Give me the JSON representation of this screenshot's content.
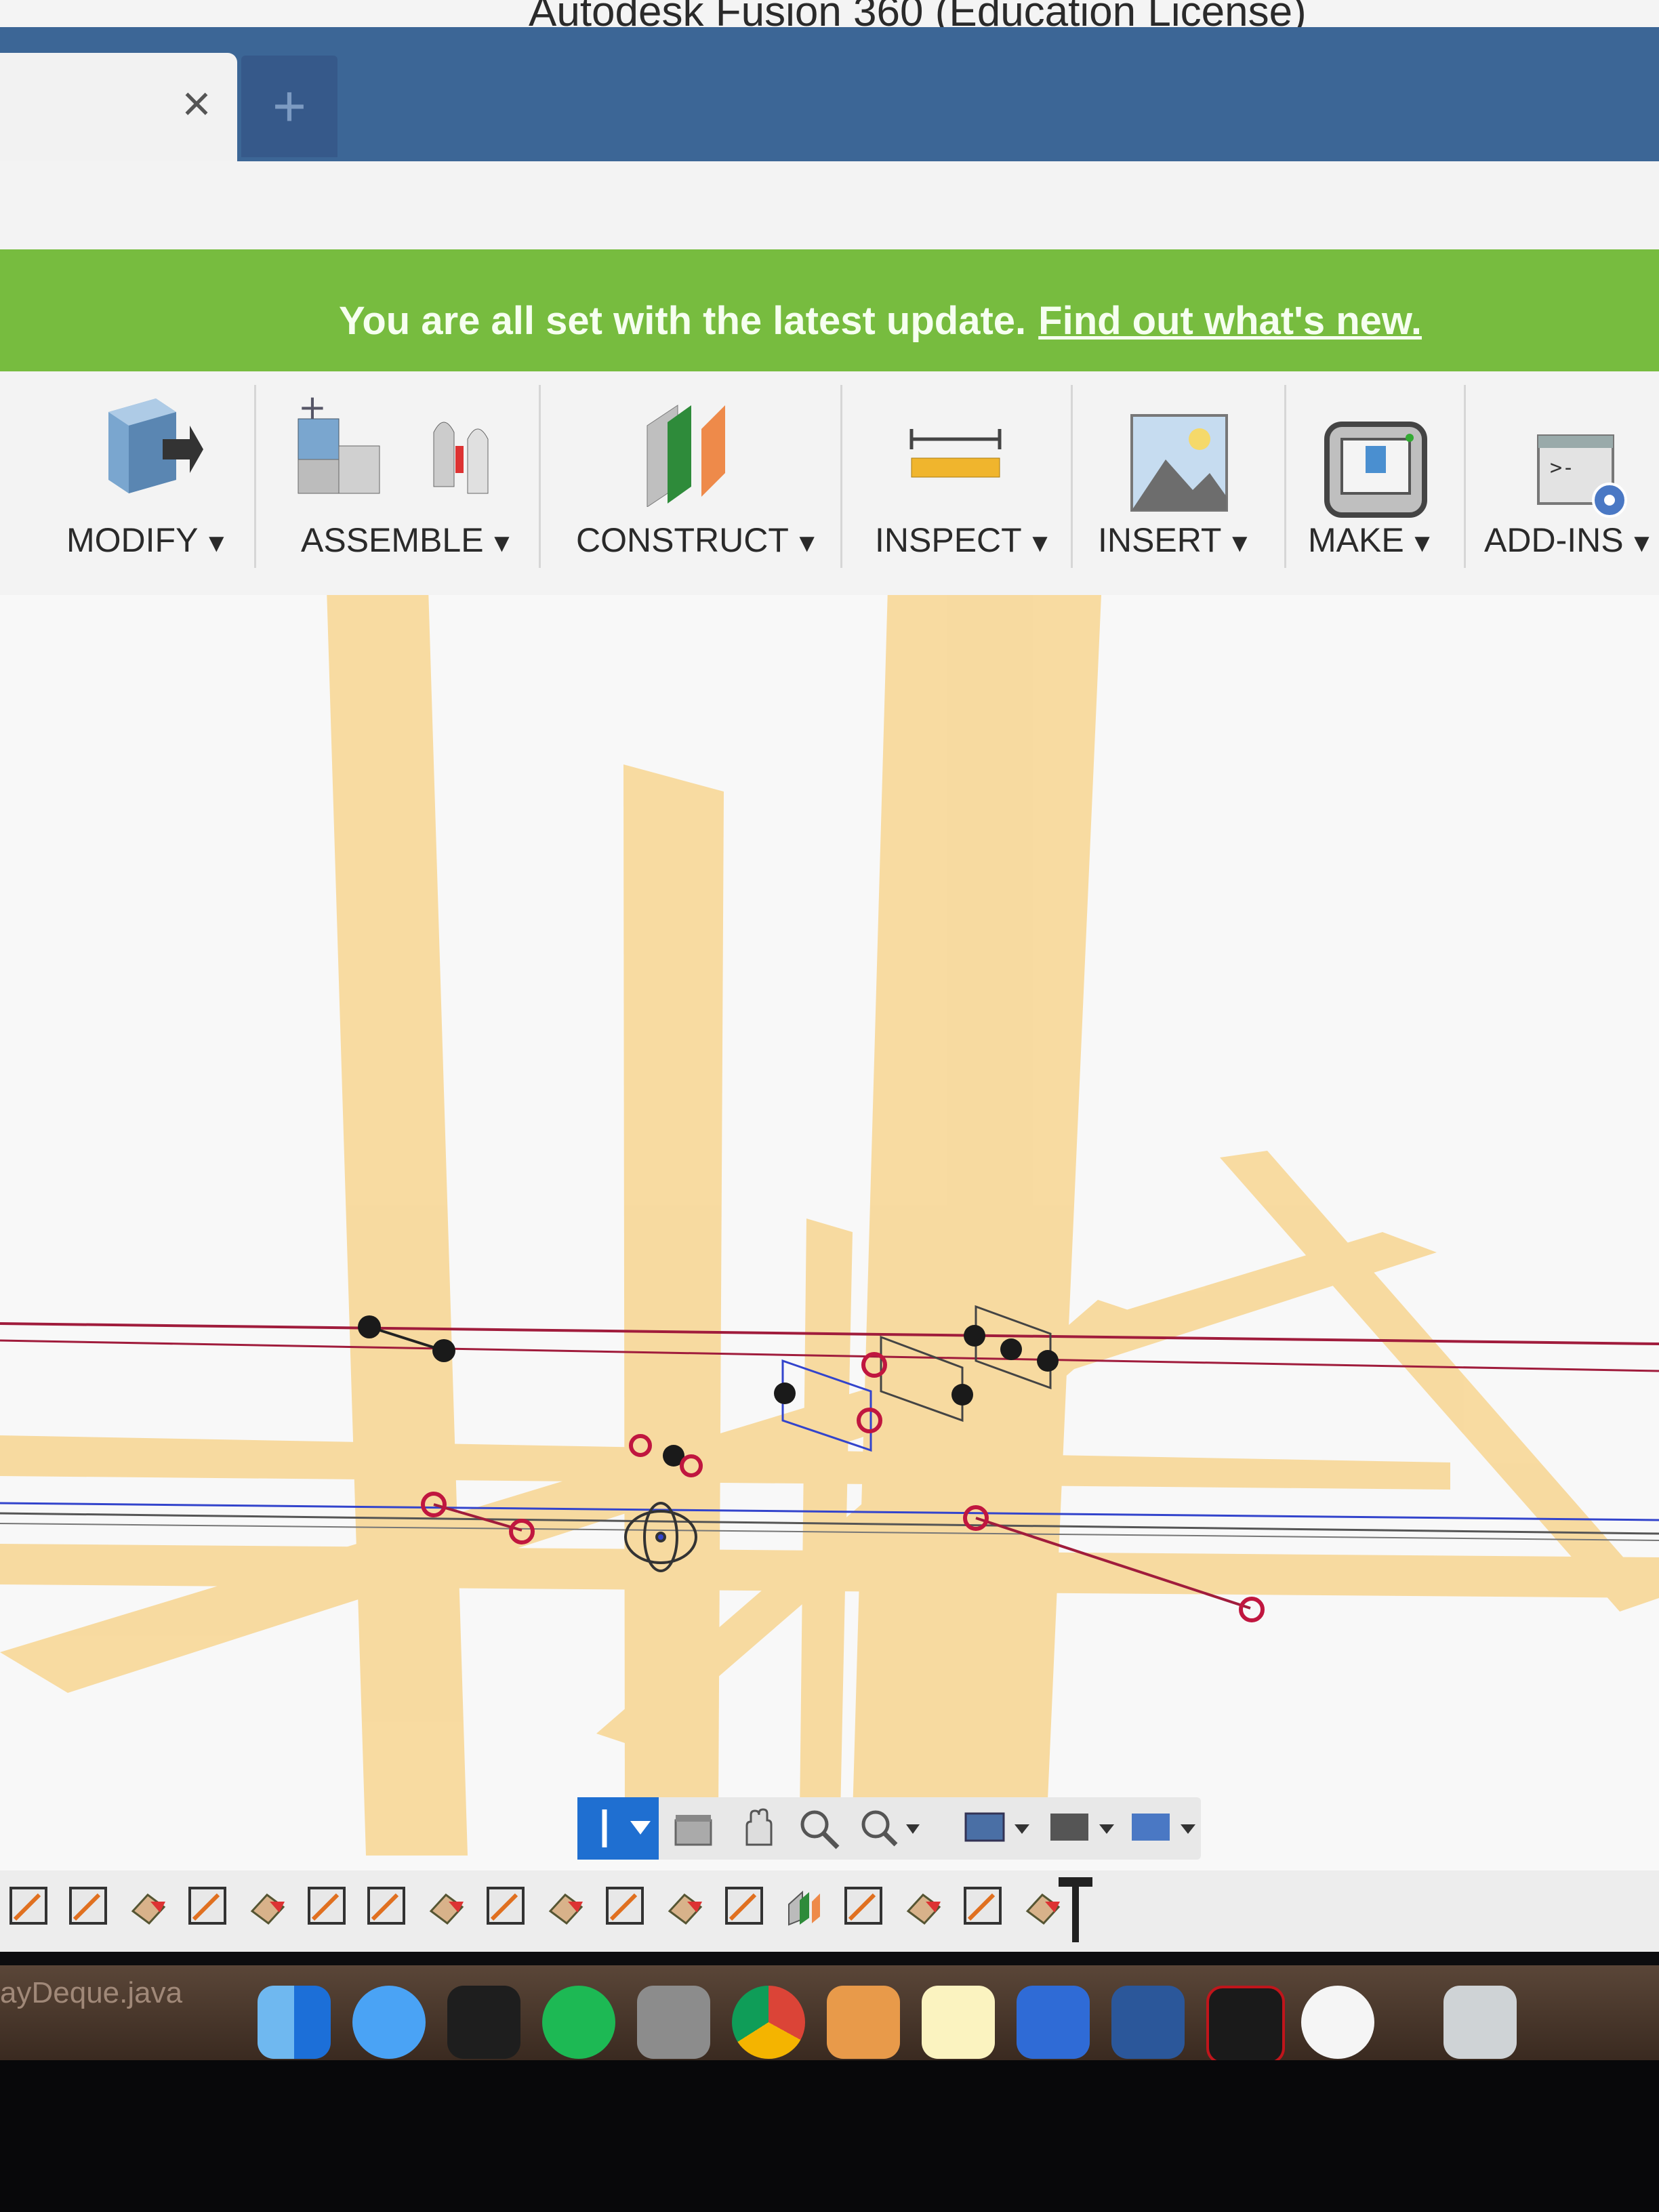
{
  "window": {
    "title": "Autodesk Fusion 360 (Education License)"
  },
  "tabs": {
    "close_glyph": "×",
    "new_tab_glyph": "+"
  },
  "notice": {
    "text": "You are all set with the latest update.",
    "link": "Find out what's new."
  },
  "toolbar": {
    "groups": [
      {
        "label": "MODIFY",
        "icon": "modify-icon"
      },
      {
        "label": "ASSEMBLE",
        "icon": "assemble-icon"
      },
      {
        "label": "CONSTRUCT",
        "icon": "construct-icon"
      },
      {
        "label": "INSPECT",
        "icon": "measure-ruler-icon"
      },
      {
        "label": "INSERT",
        "icon": "insert-image-icon"
      },
      {
        "label": "MAKE",
        "icon": "3d-print-icon"
      },
      {
        "label": "ADD-INS",
        "icon": "scripts-addins-icon"
      }
    ],
    "dropdown_glyph": "▼"
  },
  "navbar": {
    "items": [
      "orbit-icon",
      "look-at-icon",
      "pan-hand-icon",
      "zoom-icon",
      "fit-zoom-icon",
      "display-settings-icon",
      "grid-settings-icon",
      "viewports-icon"
    ]
  },
  "timeline": {
    "items": [
      "sketch-icon",
      "sketch-icon",
      "extrude-icon",
      "sketch-icon",
      "extrude-icon",
      "sketch-icon",
      "sketch-icon",
      "extrude-icon",
      "sketch-icon",
      "extrude-icon",
      "sketch-icon",
      "extrude-icon",
      "sketch-icon",
      "plane-icon",
      "sketch-icon",
      "extrude-icon",
      "sketch-icon",
      "extrude-icon"
    ]
  },
  "dock": {
    "partial_file_label": "ayDeque.java",
    "apps": [
      "finder-icon",
      "messages-icon",
      "terminal-icon",
      "spotify-icon",
      "system-preferences-icon",
      "chrome-icon",
      "fusion360-icon",
      "notes-icon",
      "xcode-icon",
      "word-icon",
      "acrobat-icon",
      "itunes-icon",
      "trash-icon"
    ]
  },
  "colors": {
    "tab_bar": "#3c6696",
    "notice_green": "#77bc3f",
    "construction_plane": "#f7c35a",
    "sketch_red": "#a01c3c",
    "sketch_blue": "#3344cc"
  }
}
